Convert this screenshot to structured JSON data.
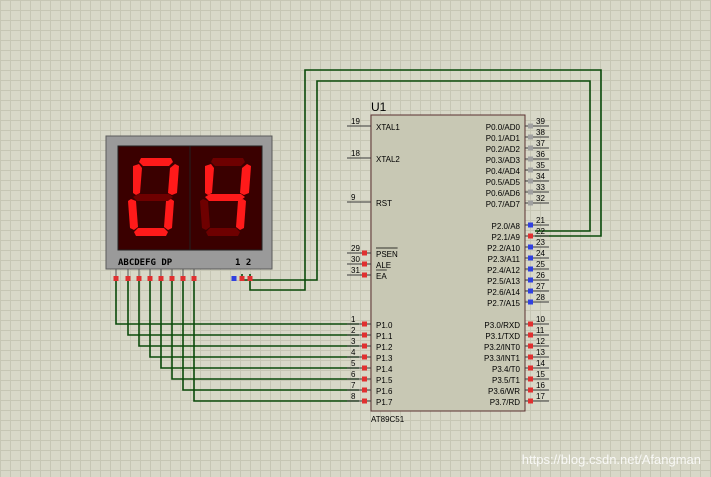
{
  "mcu": {
    "ref": "U1",
    "part": "AT89C51",
    "left_pins": [
      {
        "num": "19",
        "label": "XTAL1"
      },
      {
        "num": "18",
        "label": "XTAL2"
      },
      {
        "num": "9",
        "label": "RST"
      },
      {
        "num": "29",
        "label": "PSEN"
      },
      {
        "num": "30",
        "label": "ALE"
      },
      {
        "num": "31",
        "label": "EA"
      },
      {
        "num": "1",
        "label": "P1.0"
      },
      {
        "num": "2",
        "label": "P1.1"
      },
      {
        "num": "3",
        "label": "P1.2"
      },
      {
        "num": "4",
        "label": "P1.3"
      },
      {
        "num": "5",
        "label": "P1.4"
      },
      {
        "num": "6",
        "label": "P1.5"
      },
      {
        "num": "7",
        "label": "P1.6"
      },
      {
        "num": "8",
        "label": "P1.7"
      }
    ],
    "right_pins": [
      {
        "num": "39",
        "label": "P0.0/AD0"
      },
      {
        "num": "38",
        "label": "P0.1/AD1"
      },
      {
        "num": "37",
        "label": "P0.2/AD2"
      },
      {
        "num": "36",
        "label": "P0.3/AD3"
      },
      {
        "num": "35",
        "label": "P0.4/AD4"
      },
      {
        "num": "34",
        "label": "P0.5/AD5"
      },
      {
        "num": "33",
        "label": "P0.6/AD6"
      },
      {
        "num": "32",
        "label": "P0.7/AD7"
      },
      {
        "num": "21",
        "label": "P2.0/A8"
      },
      {
        "num": "22",
        "label": "P2.1/A9"
      },
      {
        "num": "23",
        "label": "P2.2/A10"
      },
      {
        "num": "24",
        "label": "P2.3/A11"
      },
      {
        "num": "25",
        "label": "P2.4/A12"
      },
      {
        "num": "26",
        "label": "P2.5/A13"
      },
      {
        "num": "27",
        "label": "P2.6/A14"
      },
      {
        "num": "28",
        "label": "P2.7/A15"
      },
      {
        "num": "10",
        "label": "P3.0/RXD"
      },
      {
        "num": "11",
        "label": "P3.1/TXD"
      },
      {
        "num": "12",
        "label": "P3.2/INT0"
      },
      {
        "num": "13",
        "label": "P3.3/INT1"
      },
      {
        "num": "14",
        "label": "P3.4/T0"
      },
      {
        "num": "15",
        "label": "P3.5/T1"
      },
      {
        "num": "16",
        "label": "P3.6/WR"
      },
      {
        "num": "17",
        "label": "P3.7/RD"
      }
    ]
  },
  "display": {
    "digits": [
      "0",
      "4"
    ],
    "segment_labels": "ABCDEFG DP",
    "common_labels": "1 2",
    "segment_on_color": "#ff1a1a",
    "segment_off_color": "#6e0000"
  },
  "colors": {
    "wire": "#0a4a0a",
    "chip_fill": "#c8c8b4",
    "pin_high": "#e03030",
    "pin_low": "#3040e0",
    "pin_gray": "#a0a0a0"
  },
  "watermark": "https://blog.csdn.net/Afangman"
}
